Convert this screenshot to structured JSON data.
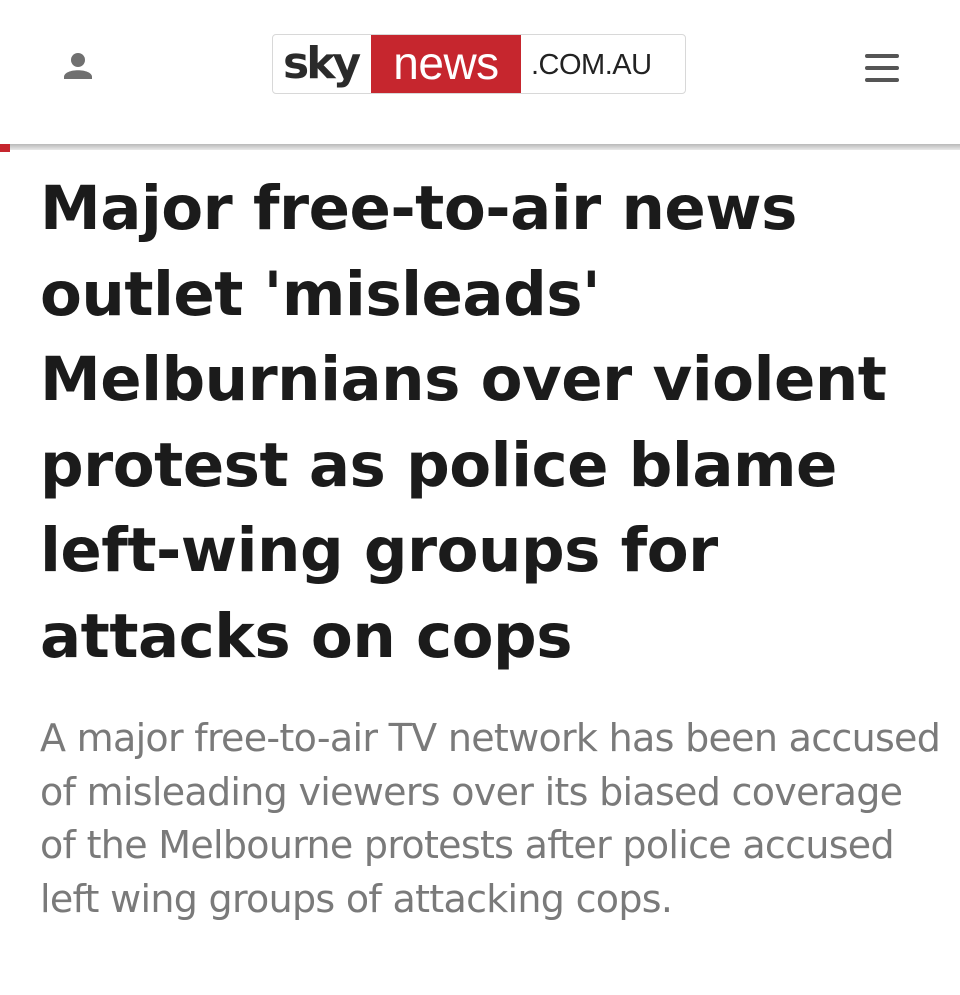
{
  "header": {
    "user_icon": "user-icon",
    "menu_icon": "hamburger-menu-icon",
    "logo": {
      "sky": "sky",
      "news": "news",
      "domain": ".COM.AU"
    }
  },
  "article": {
    "headline": "Major free-to-air news outlet 'misleads' Melburnians over violent protest as police blame left-wing groups for attacks on cops",
    "standfirst": "A major free-to-air TV network has been accused of misleading viewers over its biased coverage of the Melbourne protests after police accused left wing groups of attacking cops."
  },
  "colors": {
    "brand_red": "#c6262e",
    "headline": "#1b1b1b",
    "standfirst": "#7a7a7a"
  }
}
